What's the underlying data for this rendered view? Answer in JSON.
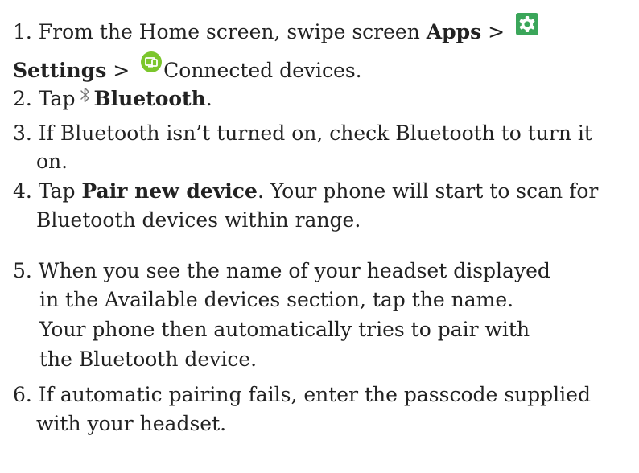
{
  "steps": {
    "s1": {
      "a": "1. From the Home screen, swipe screen ",
      "apps": "Apps",
      "sep": " >",
      "settings": "Settings",
      "sep2": " > ",
      "connected": "Connected devices."
    },
    "s2": {
      "a": "2. Tap",
      "bluetooth": "Bluetooth",
      "end": "."
    },
    "s3": {
      "line1": "3. If Bluetooth isn’t turned on, check Bluetooth to turn it",
      "line2": "on."
    },
    "s4": {
      "a": "4. Tap ",
      "pair": "Pair new device",
      "b": ". Your phone will start to scan for",
      "line2": "Bluetooth devices within range."
    },
    "s5": {
      "line1": "5. When you see the name of your headset displayed",
      "line2": "in the Available devices section, tap the name.",
      "line3": "Your phone then automatically tries to pair with",
      "line4": "the Bluetooth device."
    },
    "s6": {
      "line1": "6. If automatic pairing fails, enter the passcode supplied",
      "line2": "with your headset."
    }
  },
  "icons": {
    "settings": "settings-gear-icon",
    "connected_devices": "connected-devices-icon",
    "bluetooth": "bluetooth-icon"
  },
  "colors": {
    "settings_icon": "#3ba65a",
    "connected_icon": "#7bc62c"
  }
}
